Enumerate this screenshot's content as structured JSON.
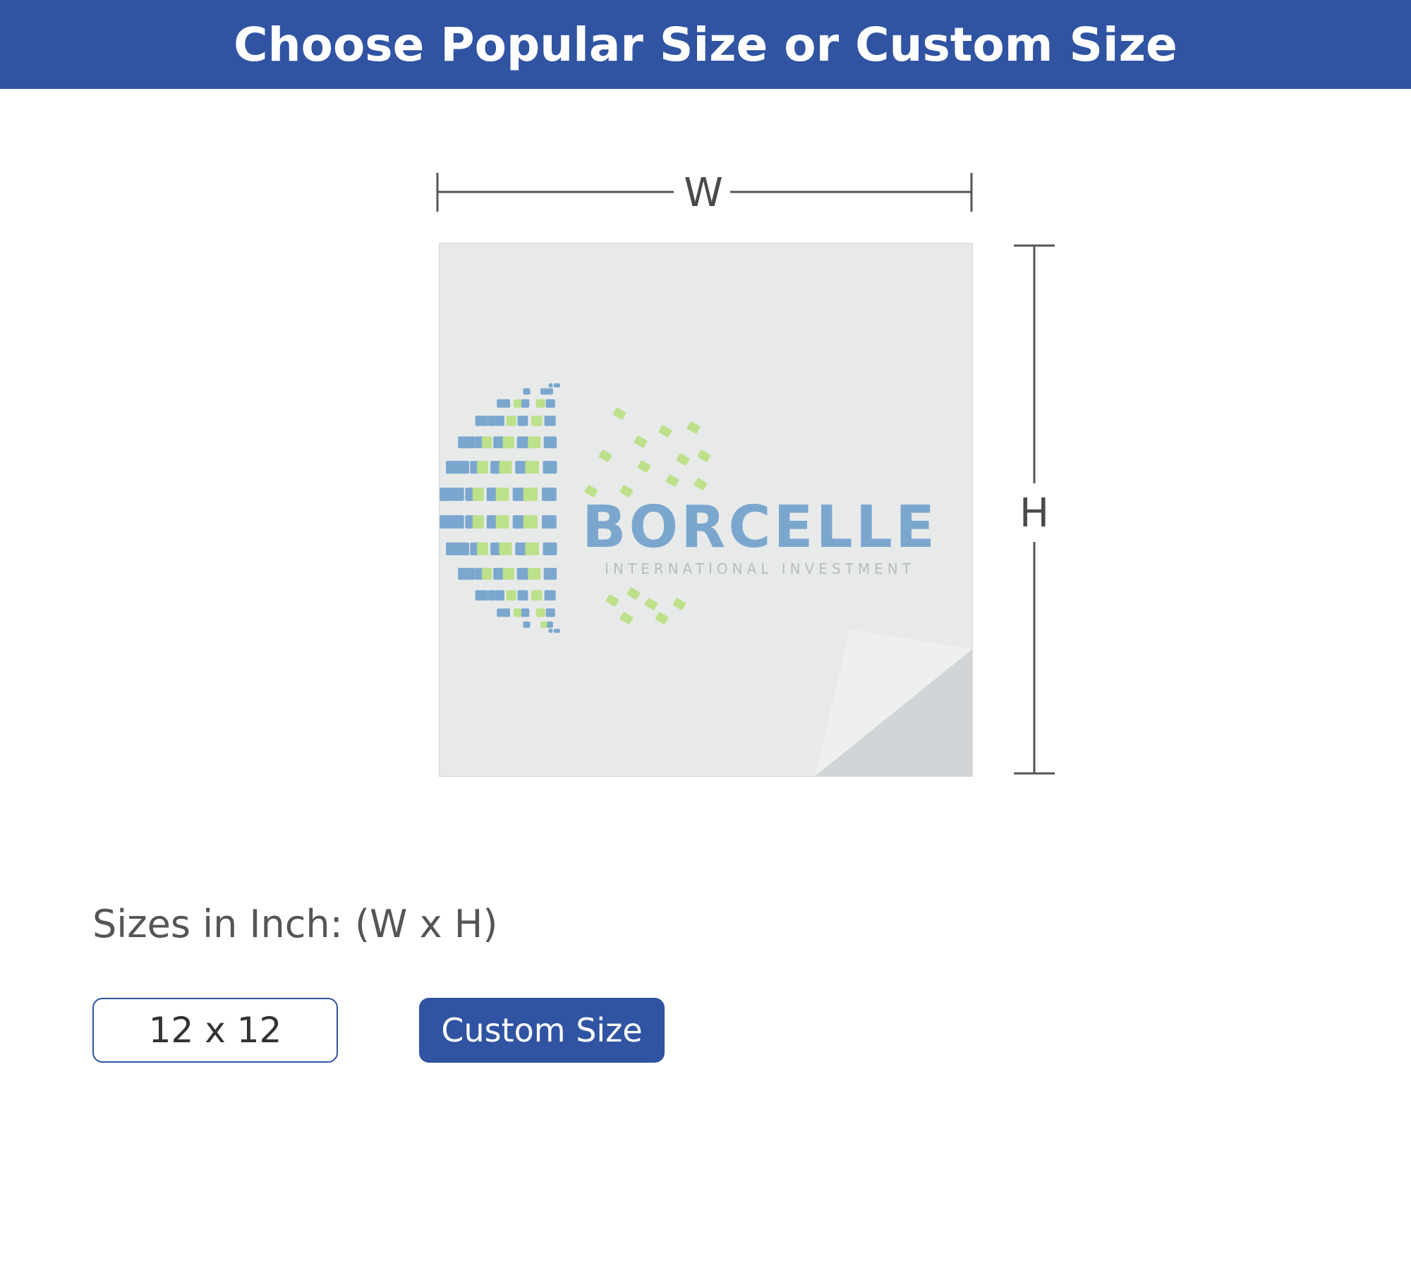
{
  "header": {
    "title": "Choose Popular Size or Custom Size"
  },
  "diagram": {
    "width_label": "W",
    "height_label": "H",
    "logo": {
      "brand": "BORCELLE",
      "tagline": "INTERNATIONAL INVESTMENT"
    }
  },
  "sizes": {
    "heading": "Sizes in Inch: (W x H)",
    "options": [
      "12 x 12"
    ],
    "custom_label": "Custom Size"
  },
  "colors": {
    "header_bg": "#3054a2",
    "button_bg": "#3054a2",
    "logo_blue": "#7ba7cf",
    "logo_green": "#bde08a",
    "sticker_bg": "#e8eaea"
  }
}
